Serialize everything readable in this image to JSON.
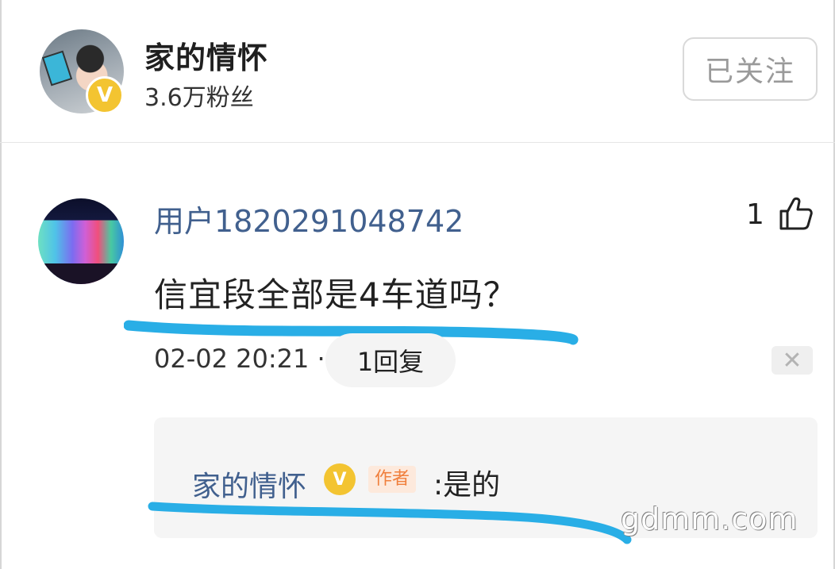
{
  "header": {
    "author_name": "家的情怀",
    "followers": "3.6万粉丝",
    "verified_badge": "V",
    "follow_button": "已关注"
  },
  "comment": {
    "username": "用户1820291048742",
    "like_count": "1",
    "text": "信宜段全部是4车道吗？",
    "timestamp": "02-02 20:21",
    "separator": "·",
    "reply_label": "1回复",
    "close_glyph": "✕",
    "highlight_color": "#29aee6"
  },
  "reply": {
    "author": "家的情怀",
    "verified_badge": "V",
    "author_tag": "作者",
    "text": ":是的"
  },
  "watermark": "gdmm.com",
  "colors": {
    "username": "#41608e",
    "verified": "#f3c431",
    "author_tag_text": "#f07f3c",
    "author_tag_bg": "#fde9dc",
    "underline": "#29aee6"
  },
  "icons": [
    "thumbs-up-icon",
    "close-icon",
    "verified-v-icon"
  ]
}
